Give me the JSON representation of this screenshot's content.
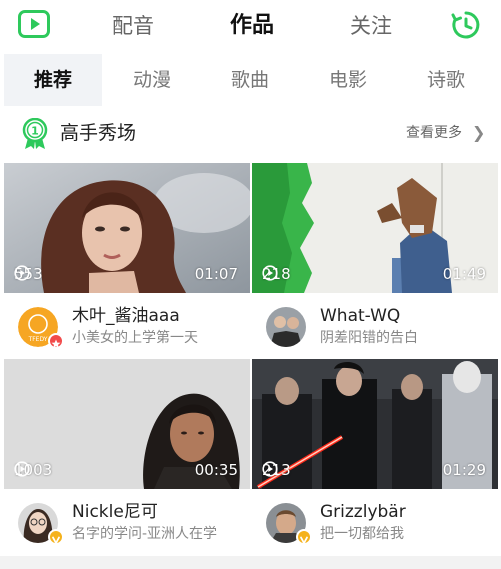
{
  "colors": {
    "accent": "#2ec95c",
    "badge_red": "#f24b4b",
    "badge_gold": "#f5b21c"
  },
  "top_nav": {
    "left_icon": "video-play-icon",
    "tabs": [
      {
        "label": "配音",
        "active": false
      },
      {
        "label": "作品",
        "active": true
      },
      {
        "label": "关注",
        "active": false
      }
    ],
    "right_icon": "clock-history-icon"
  },
  "category_tabs": [
    {
      "label": "推荐",
      "active": true
    },
    {
      "label": "动漫",
      "active": false
    },
    {
      "label": "歌曲",
      "active": false
    },
    {
      "label": "电影",
      "active": false
    },
    {
      "label": "诗歌",
      "active": false
    }
  ],
  "section": {
    "icon": "medal-icon",
    "title": "高手秀场",
    "more_label": "查看更多",
    "more_icon": "chevron-right-icon"
  },
  "cards": [
    {
      "plays": "553",
      "duration": "01:07",
      "username": "木叶_酱油aaa",
      "subtitle": "小美女的上学第一天",
      "badge": "red"
    },
    {
      "plays": "218",
      "duration": "01:49",
      "username": "What-WQ",
      "subtitle": "阴差阳错的告白",
      "badge": "none"
    },
    {
      "plays": "1003",
      "duration": "00:35",
      "username": "Nickle尼可",
      "subtitle": "名字的学问-亚洲人在学",
      "badge": "gold"
    },
    {
      "plays": "213",
      "duration": "01:29",
      "username": "Grizzlybär",
      "subtitle": "把一切都给我",
      "badge": "gold"
    }
  ]
}
